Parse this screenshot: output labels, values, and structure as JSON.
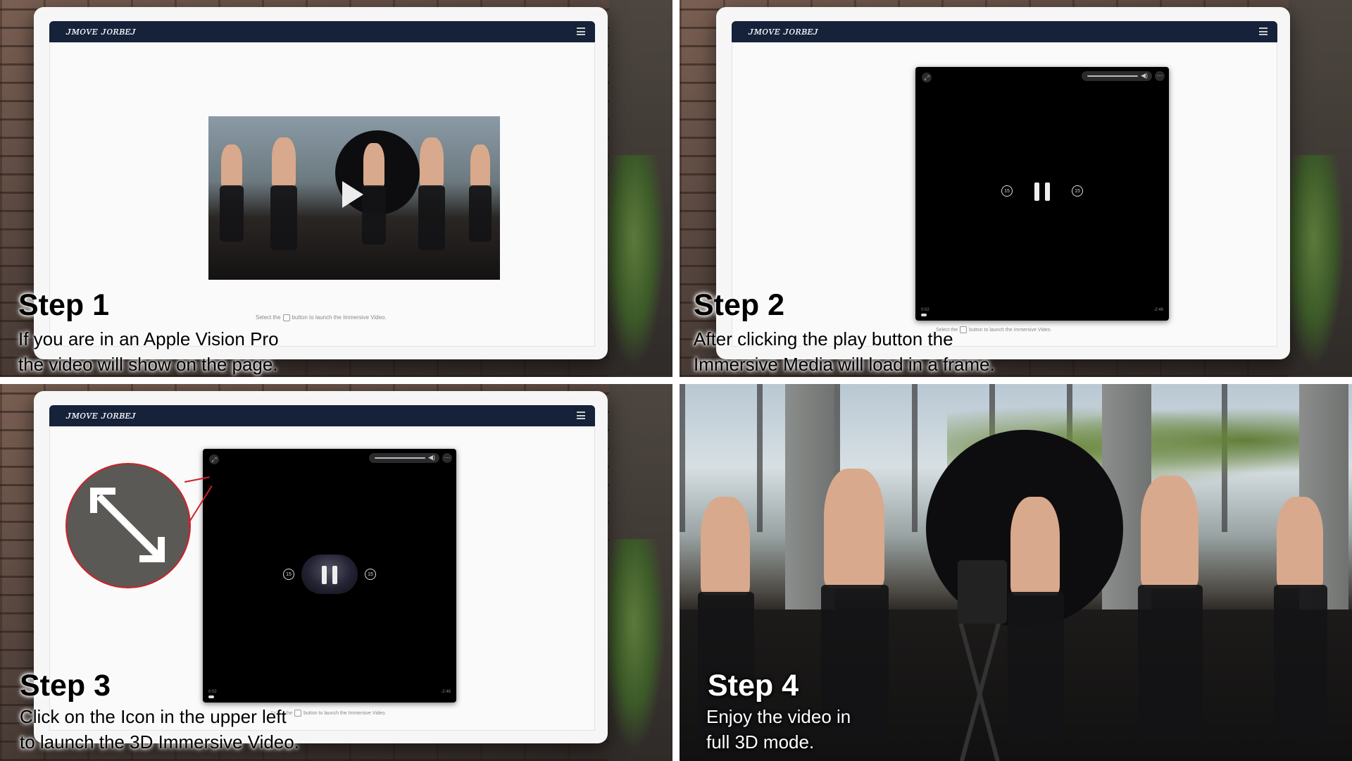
{
  "site": {
    "brand": "ᴊᴍᴏᴠᴇ ᴊᴏʀʙᴇᴊ"
  },
  "hint": {
    "before": "Select the",
    "after": "button to launch the Immersive Video."
  },
  "player": {
    "elapsed": "0:02",
    "remaining": "-2:46",
    "skip_back": "15",
    "skip_forward": "15"
  },
  "steps": [
    {
      "title": "Step 1",
      "line1": "If you are in an Apple Vision Pro",
      "line2": "the video will show on the page."
    },
    {
      "title": "Step 2",
      "line1": "After clicking the play button the",
      "line2": "Immersive Media will load in a frame."
    },
    {
      "title": "Step 3",
      "line1": "Click on the Icon in the upper left",
      "line2": "to launch the 3D Immersive Video."
    },
    {
      "title": "Step 4",
      "line1": "Enjoy the video in",
      "line2": "full 3D mode."
    }
  ],
  "icons": [
    "menu-icon",
    "play-icon",
    "pause-icon",
    "skip-back-15-icon",
    "skip-forward-15-icon",
    "expand-icon",
    "volume-icon",
    "more-icon"
  ],
  "colors": {
    "header": "#16213a",
    "callout_border": "#d0202a",
    "player_bg": "#000000"
  }
}
